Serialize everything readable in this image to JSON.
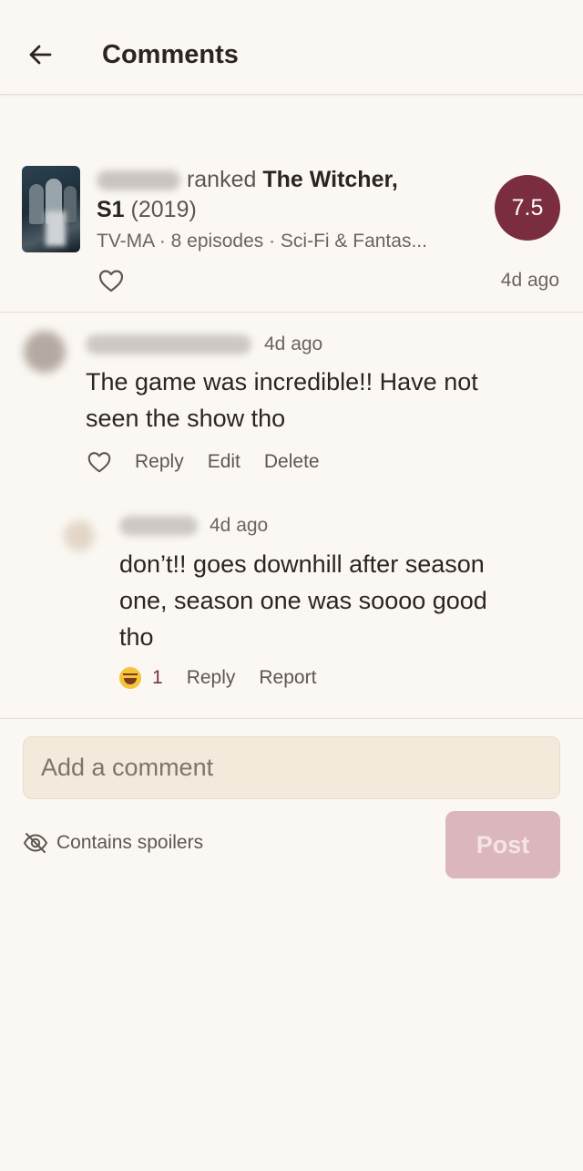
{
  "header": {
    "title": "Comments",
    "back_icon": "arrow-left-icon"
  },
  "post": {
    "action": "ranked",
    "title_part1": "The Witcher,",
    "title_part2": "S1",
    "year": "(2019)",
    "meta": "TV-MA · 8 episodes · Sci-Fi & Fantas...",
    "score": "7.5",
    "time": "4d ago",
    "score_color": "#7a2d3f"
  },
  "comments": [
    {
      "time": "4d ago",
      "text_line1": "The game was incredible!! Have not",
      "text_line2": "seen the show tho",
      "actions": {
        "reply": "Reply",
        "edit": "Edit",
        "delete": "Delete"
      }
    },
    {
      "time": "4d ago",
      "text_line1": "don’t!! goes downhill after season",
      "text_line2": "one, season one was soooo good",
      "text_line3": "tho",
      "reaction_count": "1",
      "actions": {
        "reply": "Reply",
        "report": "Report"
      }
    }
  ],
  "composer": {
    "placeholder": "Add a comment",
    "spoiler_label": "Contains spoilers",
    "post_label": "Post"
  }
}
